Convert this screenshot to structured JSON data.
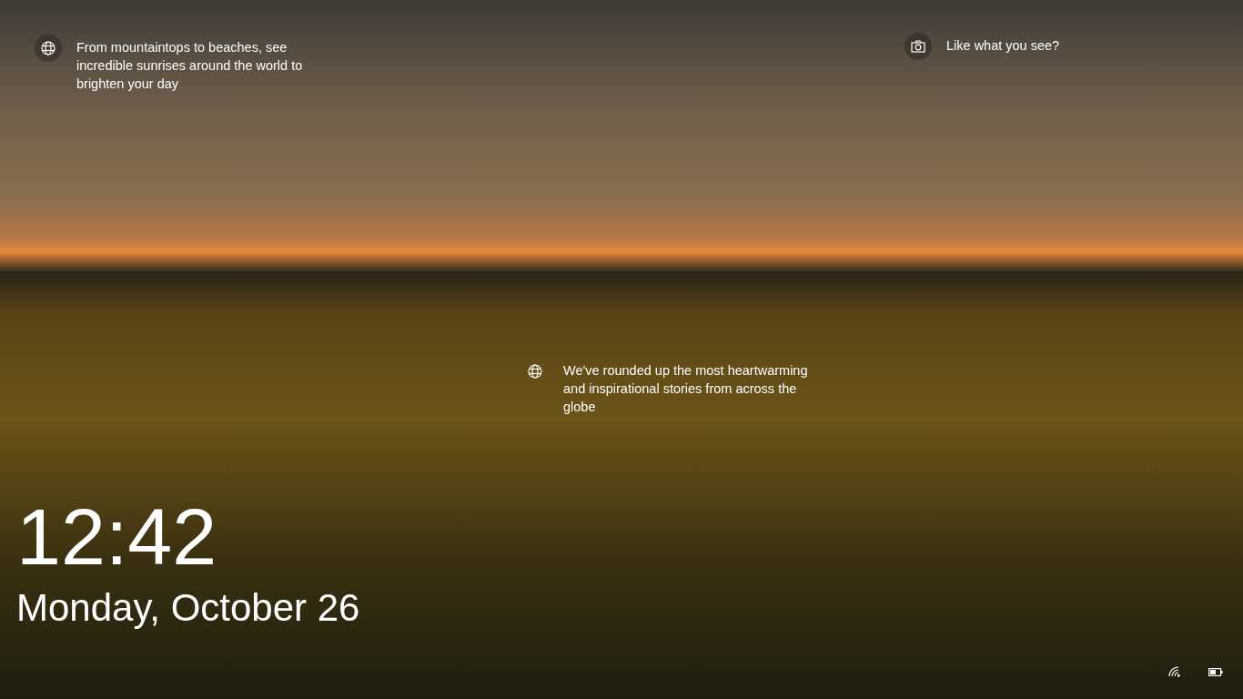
{
  "hotspots": [
    {
      "kind": "globe",
      "text": "From mountaintops to beaches, see incredible sunrises around the world to brighten your day"
    },
    {
      "kind": "camera",
      "text": "Like what you see?"
    },
    {
      "kind": "globe",
      "text": "We've rounded up the most heartwarming and inspirational stories from across the globe"
    }
  ],
  "clock": {
    "time": "12:42",
    "date": "Monday, October 26"
  },
  "status": [
    {
      "kind": "wifi"
    },
    {
      "kind": "battery"
    }
  ]
}
